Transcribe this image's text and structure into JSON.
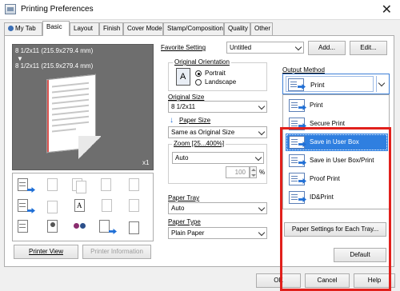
{
  "window": {
    "title": "Printing Preferences",
    "close_glyph": "✕"
  },
  "tabs": [
    "My Tab",
    "Basic",
    "Layout",
    "Finish",
    "Cover Mode",
    "Stamp/Composition",
    "Quality",
    "Other"
  ],
  "favorite": {
    "label": "Favorite Setting",
    "value": "Untitled",
    "add_label": "Add...",
    "edit_label": "Edit..."
  },
  "preview": {
    "line1": "8 1/2x11 (215.9x279.4 mm)",
    "arrow": "▼",
    "line2": "8 1/2x11 (215.9x279.4 mm)",
    "copies": "x1"
  },
  "preview_buttons": {
    "printer_view": "Printer View",
    "printer_information": "Printer Information"
  },
  "orientation": {
    "label": "Original Orientation",
    "portrait": "Portrait",
    "landscape": "Landscape",
    "selected": "Portrait"
  },
  "original_size": {
    "label": "Original Size",
    "value": "8 1/2x11"
  },
  "paper_size": {
    "label": "Paper Size",
    "value": "Same as Original Size"
  },
  "zoom": {
    "label": "Zoom [25...400%]",
    "value": "Auto",
    "percent_value": "100",
    "percent_sign": "%"
  },
  "paper_tray": {
    "label": "Paper Tray",
    "value": "Auto"
  },
  "paper_type": {
    "label": "Paper Type",
    "value": "Plain Paper"
  },
  "output_method": {
    "label": "Output Method",
    "current": "Print",
    "options": [
      "Print",
      "Secure Print",
      "Save in User Box",
      "Save in User Box/Print",
      "Proof Print",
      "ID&Print"
    ],
    "highlighted": "Save in User Box"
  },
  "paper_settings_button": "Paper Settings for Each Tray...",
  "default_button": "Default",
  "footer": {
    "ok": "OK",
    "cancel": "Cancel",
    "help": "Help"
  },
  "colors": {
    "highlight": "#2f7fe0",
    "annotation_red": "#e1201c",
    "arrow_blue": "#1f6fd6"
  }
}
